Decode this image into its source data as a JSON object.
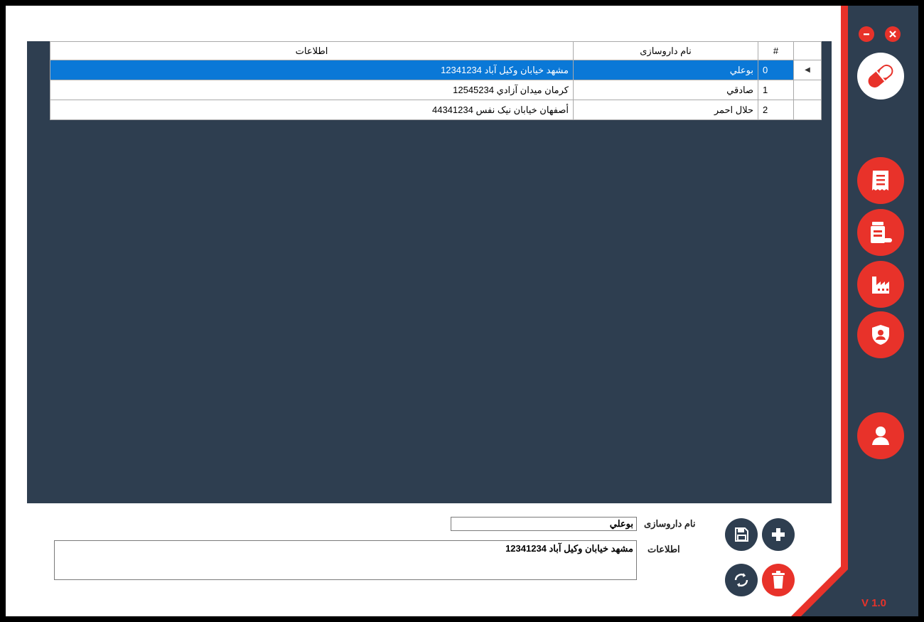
{
  "grid": {
    "headers": {
      "rownum": "#",
      "name": "نام داروسازی",
      "info": "اطلاعات"
    },
    "rows": [
      {
        "num": "0",
        "name": "بوعلي",
        "info": "مشهد خيابان وكيل آباد 12341234"
      },
      {
        "num": "1",
        "name": "صادقي",
        "info": "كرمان ميدان آزادي 12545234"
      },
      {
        "num": "2",
        "name": "حلال احمر",
        "info": "أصفهان خيابان نيک نفس 44341234"
      }
    ],
    "selected_row": 0,
    "current_row_marker": "◀"
  },
  "form": {
    "name_label": "نام داروسازی",
    "name_value": "بوعلي",
    "info_label": "اطلاعات",
    "info_value": "مشهد خيابان وكيل آباد 12341234"
  },
  "sidebar": {
    "version": "V 1.0",
    "nav_icons": [
      "prescription-icon",
      "medicine-icon",
      "factory-icon",
      "shield-user-icon"
    ],
    "user_icon": "user-icon"
  },
  "actions": [
    "save-icon",
    "add-icon",
    "refresh-icon",
    "delete-icon"
  ],
  "colors": {
    "accent": "#e8322a",
    "dark": "#2e3e50",
    "selection": "#0a78d7"
  }
}
